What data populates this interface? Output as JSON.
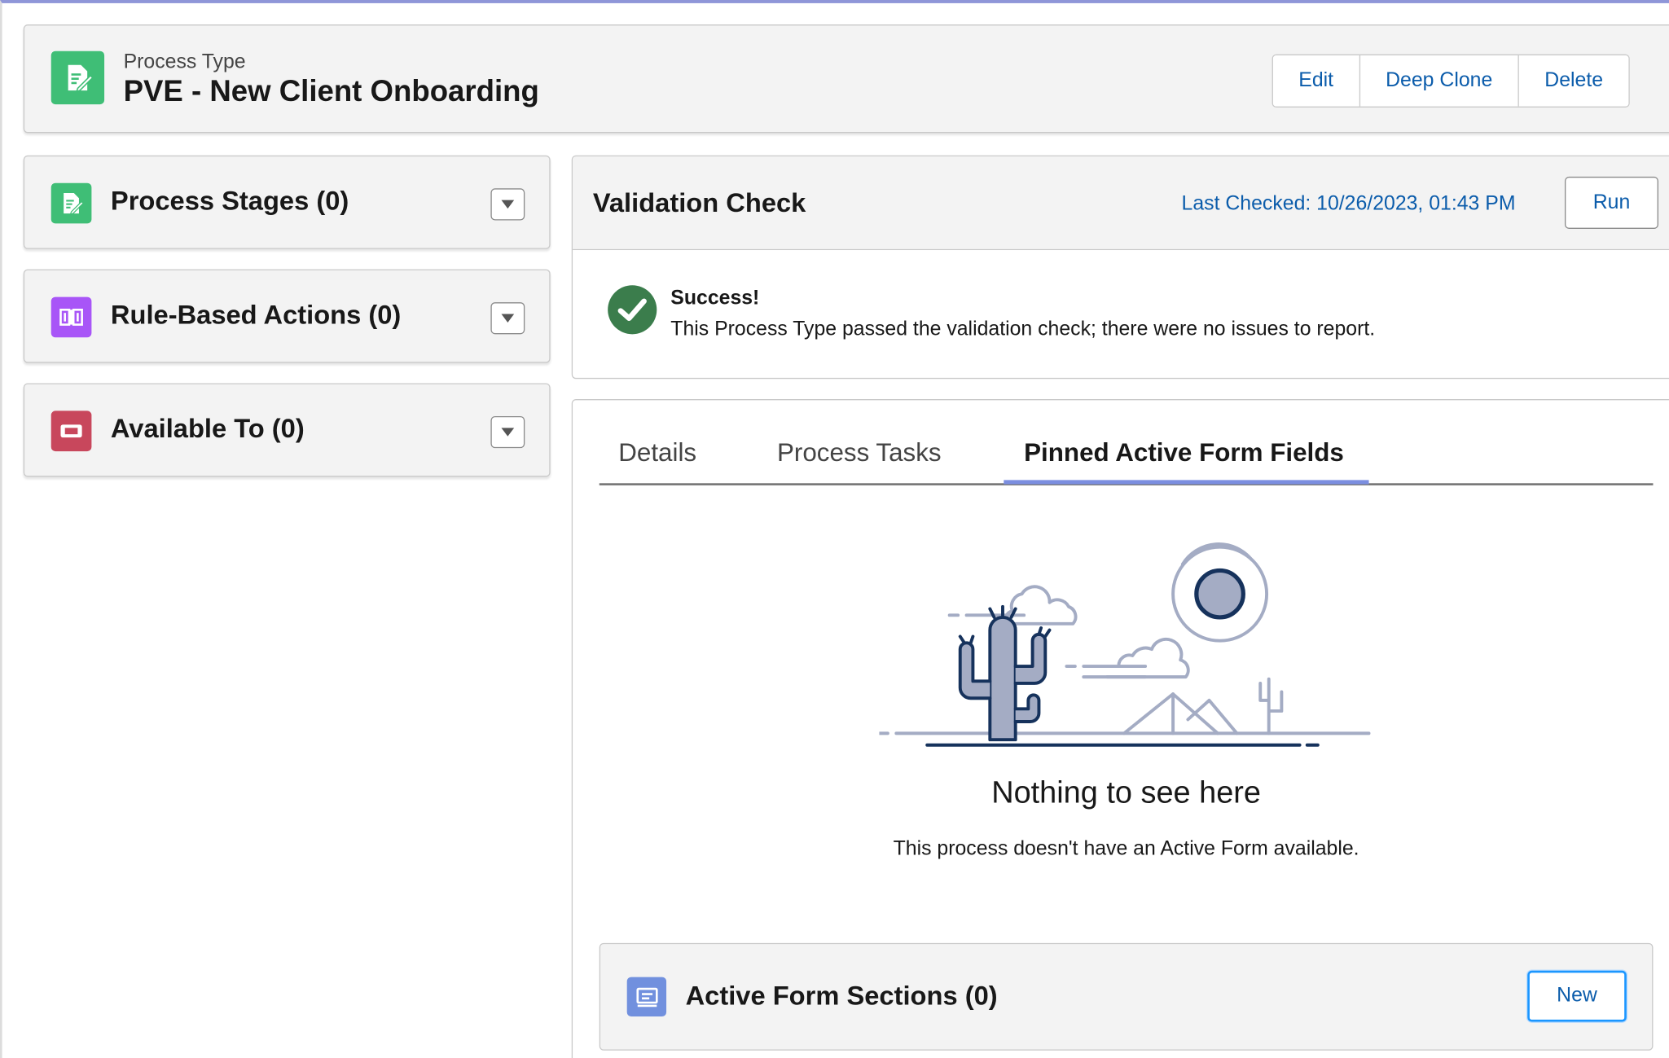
{
  "header": {
    "subtitle": "Process Type",
    "title": "PVE - New Client Onboarding",
    "icon": "form-edit-icon",
    "actions": {
      "edit": "Edit",
      "deep_clone": "Deep Clone",
      "delete": "Delete"
    }
  },
  "sidebar": {
    "cards": [
      {
        "label": "Process Stages (0)",
        "icon": "form-edit-icon",
        "color": "#3fbe76"
      },
      {
        "label": "Rule-Based Actions (0)",
        "icon": "book-icon",
        "color": "#a855f7"
      },
      {
        "label": "Available To (0)",
        "icon": "ticket-icon",
        "color": "#c8475c"
      }
    ]
  },
  "validation": {
    "title": "Validation Check",
    "last_checked": "Last Checked: 10/26/2023, 01:43 PM",
    "run_label": "Run",
    "status_title": "Success!",
    "status_message": "This Process Type passed the validation check; there were no issues to report.",
    "status_color": "#3b7d4c"
  },
  "tabs": {
    "items": [
      {
        "label": "Details",
        "active": false
      },
      {
        "label": "Process Tasks",
        "active": false
      },
      {
        "label": "Pinned Active Form Fields",
        "active": true
      }
    ],
    "accent": "#7b8ee0"
  },
  "empty_state": {
    "title": "Nothing to see here",
    "message": "This process doesn't have an Active Form available.",
    "illustration": "desert-cactus-illustration"
  },
  "sections": {
    "title": "Active Form Sections (0)",
    "new_label": "New",
    "icon": "form-section-icon",
    "color": "#7190de"
  },
  "colors": {
    "link": "#0b5cab",
    "card_bg": "#f3f3f3",
    "border": "#c9c9c9"
  }
}
